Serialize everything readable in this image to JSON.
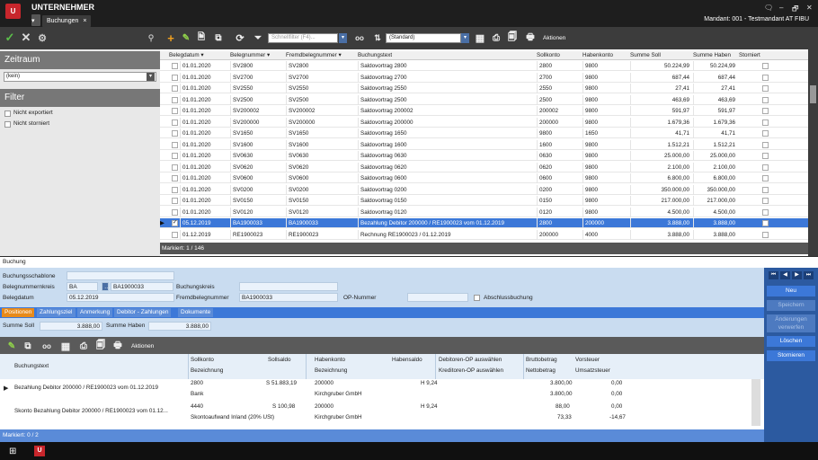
{
  "app": {
    "name": "UNTERNEHMER",
    "tab_label": "Buchungen",
    "tab_close": "×",
    "mandant": "Mandant: 001 - Testmandant AT FIBU",
    "logo_text": "U"
  },
  "window": {
    "chat": "🗨",
    "minimize": "–",
    "maximize": "🗗",
    "close": "✕"
  },
  "toolbar": {
    "search_placeholder": "Schnellfilter (F4)...",
    "standard_value": "(Standard)",
    "actions_label": "Aktionen"
  },
  "left": {
    "zeitraum_title": "Zeitraum",
    "zeitraum_value": "(kein)",
    "filter_title": "Filter",
    "filter_items": [
      "Nicht exportiert",
      "Nicht storniert"
    ]
  },
  "grid": {
    "columns": [
      "Belegdatum",
      "Belegnummer",
      "Fremdbelegnummer",
      "Buchungstext",
      "Sollkonto",
      "Habenkonto",
      "Summe Soll",
      "Summe Haben",
      "Storniert"
    ],
    "rows": [
      [
        "01.01.2020",
        "SV2800",
        "SV2800",
        "Saldovortrag 2800",
        "2800",
        "9800",
        "50.224,99",
        "50.224,99"
      ],
      [
        "01.01.2020",
        "SV2700",
        "SV2700",
        "Saldovortrag 2700",
        "2700",
        "9800",
        "687,44",
        "687,44"
      ],
      [
        "01.01.2020",
        "SV2550",
        "SV2550",
        "Saldovortrag 2550",
        "2550",
        "9800",
        "27,41",
        "27,41"
      ],
      [
        "01.01.2020",
        "SV2500",
        "SV2500",
        "Saldovortrag 2500",
        "2500",
        "9800",
        "463,69",
        "463,69"
      ],
      [
        "01.01.2020",
        "SV200002",
        "SV200002",
        "Saldovortrag 200002",
        "200002",
        "9800",
        "591,97",
        "591,97"
      ],
      [
        "01.01.2020",
        "SV200000",
        "SV200000",
        "Saldovortrag 200000",
        "200000",
        "9800",
        "1.679,36",
        "1.679,36"
      ],
      [
        "01.01.2020",
        "SV1650",
        "SV1650",
        "Saldovortrag 1650",
        "9800",
        "1650",
        "41,71",
        "41,71"
      ],
      [
        "01.01.2020",
        "SV1600",
        "SV1600",
        "Saldovortrag 1600",
        "1600",
        "9800",
        "1.512,21",
        "1.512,21"
      ],
      [
        "01.01.2020",
        "SV0630",
        "SV0630",
        "Saldovortrag 0630",
        "0630",
        "9800",
        "25.000,00",
        "25.000,00"
      ],
      [
        "01.01.2020",
        "SV0620",
        "SV0620",
        "Saldovortrag 0620",
        "0620",
        "9800",
        "2.100,00",
        "2.100,00"
      ],
      [
        "01.01.2020",
        "SV0600",
        "SV0600",
        "Saldovortrag 0600",
        "0600",
        "9800",
        "6.800,00",
        "6.800,00"
      ],
      [
        "01.01.2020",
        "SV0200",
        "SV0200",
        "Saldovortrag 0200",
        "0200",
        "9800",
        "350.000,00",
        "350.000,00"
      ],
      [
        "01.01.2020",
        "SV0150",
        "SV0150",
        "Saldovortrag 0150",
        "0150",
        "9800",
        "217.000,00",
        "217.000,00"
      ],
      [
        "01.01.2020",
        "SV0120",
        "SV0120",
        "Saldovortrag 0120",
        "0120",
        "9800",
        "4.500,00",
        "4.500,00"
      ],
      [
        "05.12.2019",
        "BA1900033",
        "BA1900033",
        "Bezahlung Debitor 200000 / RE1900023 vom 01.12.2019",
        "2800",
        "200000",
        "3.888,00",
        "3.888,00"
      ],
      [
        "01.12.2019",
        "RE1900023",
        "RE1900023",
        "Rechnung RE1900023 / 01.12.2019",
        "200000",
        "4000",
        "3.888,00",
        "3.888,00"
      ]
    ],
    "selected_row": 14,
    "footer": "Markiert: 1 / 146"
  },
  "booking": {
    "header": "Buchung",
    "labels": {
      "schablone": "Buchungsschablone",
      "kreis": "Belegnummernkreis",
      "datum": "Belegdatum",
      "buchungskreis": "Buchungskreis",
      "fremd": "Fremdbelegnummer",
      "op": "OP-Nummer",
      "abschluss": "Abschlussbuchung"
    },
    "values": {
      "kreis_code": "BA",
      "kreis_nr": "BA1900033",
      "datum": "05.12.2019",
      "fremd": "BA1900033"
    },
    "tabs": [
      "Positionen",
      "Zahlungsziel",
      "Anmerkung",
      "Debitor - Zahlungen",
      "Dokumente"
    ],
    "summe_soll_label": "Summe Soll",
    "summe_soll": "3.888,00",
    "summe_haben_label": "Summe Haben",
    "summe_haben": "3.888,00",
    "actions_label": "Aktionen"
  },
  "positions": {
    "headers": {
      "text": "Buchungstext",
      "sollkonto": "Sollkonto",
      "sollsaldo": "Sollsaldo",
      "bezeichnung": "Bezeichnung",
      "habenkonto": "Habenkonto",
      "habensaldo": "Habensaldo",
      "bezeichnung2": "Bezeichnung",
      "debop": "Debitoren-OP auswählen",
      "kredop": "Kreditoren-OP auswählen",
      "brutto": "Bruttobetrag",
      "netto": "Nettobetrag",
      "vorsteuer": "Vorsteuer",
      "ust": "Umsatzsteuer"
    },
    "rows": [
      {
        "text": "Bezahlung Debitor 200000 / RE1900023 vom 01.12.2019",
        "soll": "2800",
        "sollsaldo": "S 51.883,19",
        "haben": "200000",
        "habensaldo": "H 9,24",
        "brutto": "3.800,00",
        "vst": "0,00",
        "bez": "Bank",
        "bez2": "Kirchgruber GmbH",
        "netto": "3.800,00",
        "ust": "0,00"
      },
      {
        "text": "Skonto Bezahlung Debitor 200000 / RE1900023 vom 01.12...",
        "soll": "4440",
        "sollsaldo": "S 100,98",
        "haben": "200000",
        "habensaldo": "H 9,24",
        "brutto": "88,00",
        "vst": "0,00",
        "bez": "Skontoaufwand Inland (20% USt)",
        "bez2": "Kirchgruber GmbH",
        "netto": "73,33",
        "ust": "-14,67"
      }
    ],
    "footer": "Markiert: 0 / 2"
  },
  "right_actions": {
    "nav": [
      "⏮",
      "◀",
      "▶",
      "⏭"
    ],
    "buttons": [
      "Neu",
      "Speichern",
      "Änderungen verwerfen",
      "Löschen",
      "Stornieren"
    ]
  },
  "colors": {
    "accent": "#3c78d8",
    "active_tab": "#e88a1a",
    "logo": "#c8262c"
  }
}
